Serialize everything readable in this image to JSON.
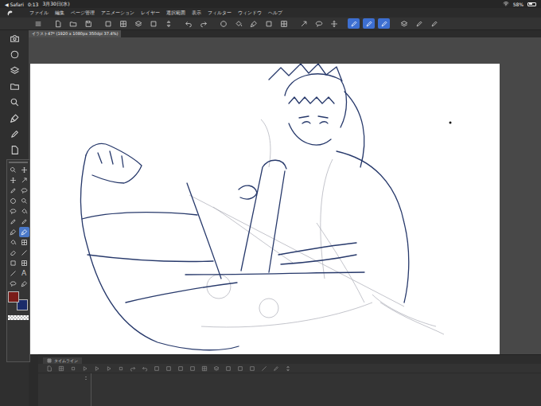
{
  "status_bar": {
    "back": "◀ Safari",
    "time": "0:13",
    "date": "3月30日(水)",
    "battery": "58%",
    "battery_level": 0.58
  },
  "menu": [
    "ファイル",
    "編集",
    "ページ管理",
    "アニメーション",
    "レイヤー",
    "選択範囲",
    "表示",
    "フィルター",
    "ウィンドウ",
    "ヘルプ"
  ],
  "command_bar": {
    "buttons": [
      {
        "selected": false
      },
      {
        "selected": false
      },
      {
        "selected": false
      },
      {
        "selected": false
      },
      {
        "selected": false
      },
      {
        "selected": false
      },
      {
        "selected": false
      },
      {
        "selected": false
      },
      {
        "selected": false
      },
      {
        "selected": false
      },
      {
        "selected": false
      },
      {
        "selected": false
      },
      {
        "selected": false
      },
      {
        "selected": false
      },
      {
        "selected": false
      },
      {
        "selected": false
      },
      {
        "selected": false
      },
      {
        "selected": false
      },
      {
        "selected": false
      },
      {
        "selected": true
      },
      {
        "selected": true
      },
      {
        "selected": true
      },
      {
        "selected": false
      },
      {
        "selected": false
      },
      {
        "selected": false
      }
    ]
  },
  "document_tab": {
    "label": "イラスト47* (1920 x 1080px 350dpi 37.4%)",
    "selected": true
  },
  "tool_palette": {
    "tools": [
      {
        "selected": false
      },
      {
        "selected": false
      },
      {
        "selected": false
      },
      {
        "selected": false
      },
      {
        "selected": false
      },
      {
        "selected": false
      },
      {
        "selected": false
      },
      {
        "selected": false
      },
      {
        "selected": false
      },
      {
        "selected": false
      },
      {
        "selected": false
      },
      {
        "selected": false
      },
      {
        "selected": false
      },
      {
        "selected": true
      },
      {
        "selected": false
      },
      {
        "selected": false
      },
      {
        "selected": false
      },
      {
        "selected": false
      },
      {
        "selected": false
      },
      {
        "selected": false
      },
      {
        "selected": false
      },
      {
        "label": "A",
        "selected": false
      },
      {
        "selected": false
      },
      {
        "selected": false
      }
    ],
    "colors": [
      {
        "color": "#7a1c18",
        "selected": true
      },
      {
        "color": "#1b2c6a",
        "selected": false
      }
    ]
  },
  "timeline": {
    "tab": "タイムライン"
  }
}
